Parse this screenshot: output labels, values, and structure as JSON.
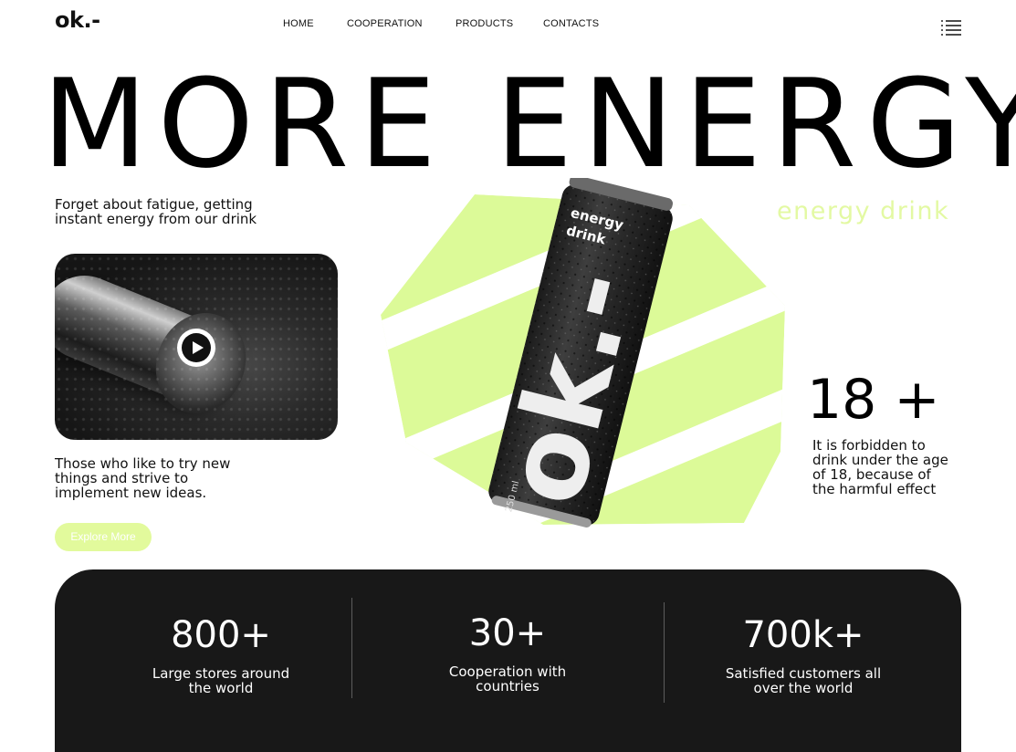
{
  "brand": {
    "logo": "ok.-"
  },
  "nav": {
    "items": [
      "HOME",
      "COOPERATION",
      "PRODUCTS",
      "CONTACTS"
    ]
  },
  "hero": {
    "headline": "MORE ENERGY",
    "tagline": "Forget about fatigue, getting instant  energy from our drink",
    "description": "Those who like to try new things and strive to implement new ideas.",
    "cta_label": "Explore More",
    "product_label": "energy drink"
  },
  "can": {
    "label_top": "energy",
    "label_bottom": "drink",
    "volume": "250 ml",
    "brand_mark": "ok.-"
  },
  "age_warning": {
    "value": "18 +",
    "text": "It is forbidden to drink under the age of 18, because of the harmful effect"
  },
  "stats": [
    {
      "value": "800+",
      "label": "Large stores around the world"
    },
    {
      "value": "30+",
      "label": "Cooperation with countries"
    },
    {
      "value": "700k+",
      "label": "Satisfied customers all over the world"
    }
  ],
  "colors": {
    "accent": "#e0fa98",
    "dark_panel": "#181818",
    "text": "#111111"
  },
  "icons": {
    "menu": "hamburger-list-icon",
    "play": "play-icon"
  }
}
